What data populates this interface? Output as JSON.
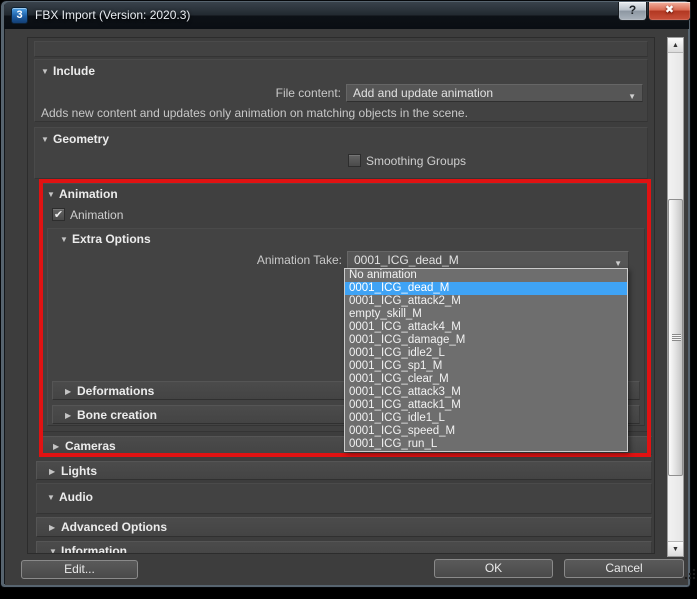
{
  "titlebar": {
    "title": "FBX Import (Version: 2020.3)"
  },
  "icons": {
    "app": "3",
    "help": "?",
    "close": "✖",
    "expanded_arrow": "▼",
    "collapsed_arrow": "▶",
    "combo_arrow": "▼",
    "check": "✔",
    "scroll_up": "▲",
    "scroll_down": "▼"
  },
  "sections": {
    "include": "Include",
    "geometry": "Geometry",
    "animation": "Animation",
    "extra_options": "Extra Options",
    "deformations": "Deformations",
    "bone_creation": "Bone creation",
    "cameras": "Cameras",
    "lights": "Lights",
    "audio": "Audio",
    "advanced_options": "Advanced Options",
    "information": "Information"
  },
  "include": {
    "file_content_label": "File content:",
    "file_content_value": "Add and update animation",
    "description": "Adds new content and updates only animation on matching objects in the scene."
  },
  "geometry": {
    "smoothing_groups_label": "Smoothing Groups",
    "smoothing_groups_checked": false
  },
  "animation": {
    "checkbox_label": "Animation",
    "checkbox_checked": true,
    "take_label": "Animation Take:",
    "take_value": "0001_ICG_dead_M"
  },
  "take_dropdown": {
    "open": true,
    "selected": "0001_ICG_dead_M",
    "items": [
      "No animation",
      "0001_ICG_dead_M",
      "0001_ICG_attack2_M",
      "empty_skill_M",
      "0001_ICG_attack4_M",
      "0001_ICG_damage_M",
      "0001_ICG_idle2_L",
      "0001_ICG_sp1_M",
      "0001_ICG_clear_M",
      "0001_ICG_attack3_M",
      "0001_ICG_attack1_M",
      "0001_ICG_idle1_L",
      "0001_ICG_speed_M",
      "0001_ICG_run_L"
    ]
  },
  "footer": {
    "edit": "Edit...",
    "ok": "OK",
    "cancel": "Cancel"
  },
  "colors": {
    "selection_blue": "#3fa3f5",
    "annotation_red": "#e01212",
    "dialog_bg": "#3d3d3d"
  }
}
